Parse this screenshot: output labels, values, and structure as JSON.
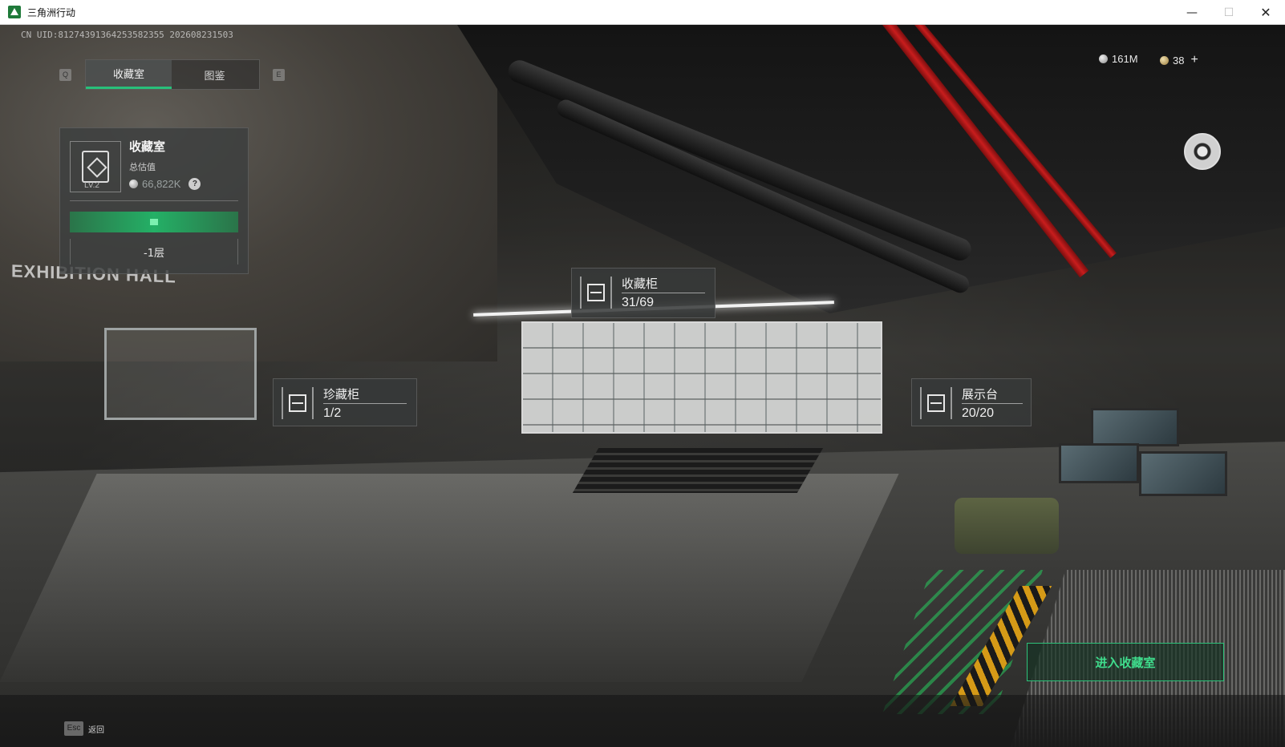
{
  "window": {
    "title": "三角洲行动",
    "minimize": "—",
    "maximize": "☐",
    "close": "✕"
  },
  "hud": {
    "uid": "CN UID:8127439136425358235​5 202608231503",
    "key_prev": "Q",
    "key_next": "E",
    "tabs": [
      {
        "label": "收藏室",
        "active": true
      },
      {
        "label": "图鉴",
        "active": false
      }
    ],
    "currency": [
      {
        "value": "161M",
        "icon": "silver-coin-icon"
      },
      {
        "value": "38",
        "icon": "gold-coin-icon"
      }
    ],
    "plus": "+"
  },
  "scene": {
    "hall_sign": "EXHIBITION HALL"
  },
  "collection": {
    "title": "收藏室",
    "level": "LV.2",
    "subtitle": "总估值",
    "value": "66,822K",
    "help": "?",
    "floor": "-1层"
  },
  "tags": [
    {
      "name": "收藏柜",
      "count": "31/69",
      "icon": "cabinet-icon"
    },
    {
      "name": "珍藏柜",
      "count": "1/2",
      "icon": "treasure-case-icon"
    },
    {
      "name": "展示台",
      "count": "20/20",
      "icon": "display-stand-icon"
    }
  ],
  "actions": {
    "enter": "进入收藏室",
    "esc_key": "Esc",
    "esc_label": "返回"
  },
  "colors": {
    "accent_green": "#28c07a",
    "panel_bg": "#3c3e3e"
  }
}
